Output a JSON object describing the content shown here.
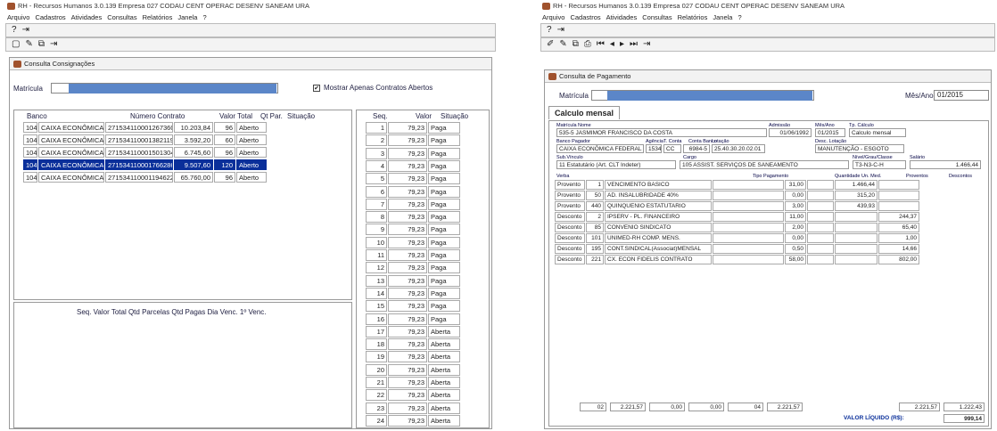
{
  "app": {
    "title": "RH - Recursos Humanos 3.0.139 Empresa 027 CODAU CENT OPERAC DESENV SANEAM URA",
    "menu": [
      "Arquivo",
      "Cadastros",
      "Atividades",
      "Consultas",
      "Relatórios",
      "Janela",
      "?"
    ]
  },
  "consig": {
    "window_title": "Consulta Consignações",
    "matricula_label": "Matrícula",
    "checkbox_label": "Mostrar Apenas Contratos Abertos",
    "checkbox_mark": "✔",
    "headers": [
      "Banco",
      "Número Contrato",
      "Valor Total",
      "Qt Par.",
      "Situação"
    ],
    "rows": [
      [
        "104",
        "CAIXA ECONÔMICA",
        "271534110001267360",
        "10.203,84",
        "96",
        "Aberto"
      ],
      [
        "104",
        "CAIXA ECONÔMICA",
        "271534110001382119",
        "3.592,20",
        "60",
        "Aberto"
      ],
      [
        "104",
        "CAIXA ECONÔMICA",
        "271534110001501304",
        "6.745,60",
        "96",
        "Aberto"
      ],
      [
        "104",
        "CAIXA ECONÔMICA",
        "271534110001766286",
        "9.507,60",
        "120",
        "Aberto"
      ],
      [
        "104",
        "CAIXA ECONÔMICA",
        "271534110001194622",
        "65.760,00",
        "96",
        "Aberto"
      ]
    ],
    "selected_row": 3,
    "bottom_headers": "Seq.  Valor Total  Qtd Parcelas Qtd Pagas Dia Venc.  1º Venc.",
    "seq_headers": [
      "Seq.",
      "Valor",
      "Situação"
    ],
    "parcel_value": "79,23",
    "parcels": [
      [
        "1",
        "Paga"
      ],
      [
        "2",
        "Paga"
      ],
      [
        "3",
        "Paga"
      ],
      [
        "4",
        "Paga"
      ],
      [
        "5",
        "Paga"
      ],
      [
        "6",
        "Paga"
      ],
      [
        "7",
        "Paga"
      ],
      [
        "8",
        "Paga"
      ],
      [
        "9",
        "Paga"
      ],
      [
        "10",
        "Paga"
      ],
      [
        "11",
        "Paga"
      ],
      [
        "12",
        "Paga"
      ],
      [
        "13",
        "Paga"
      ],
      [
        "14",
        "Paga"
      ],
      [
        "15",
        "Paga"
      ],
      [
        "16",
        "Paga"
      ],
      [
        "17",
        "Aberta"
      ],
      [
        "18",
        "Aberta"
      ],
      [
        "19",
        "Aberta"
      ],
      [
        "20",
        "Aberta"
      ],
      [
        "21",
        "Aberta"
      ],
      [
        "22",
        "Aberta"
      ],
      [
        "23",
        "Aberta"
      ],
      [
        "24",
        "Aberta"
      ]
    ]
  },
  "pag": {
    "window_title": "Consulta de Pagamento",
    "matricula_label": "Matrícula",
    "mes_label": "Mês/Ano",
    "mes_value": "01/2015",
    "tab_label": "Calculo mensal",
    "lbl_matricula": "Matrícula",
    "lbl_nome": "Nome",
    "lbl_admissao": "Admissão",
    "lbl_mesano": "Mês/Ano",
    "lbl_calculo": "Tp. Cálculo",
    "matricula_val": "535-5",
    "nome_val": "JASMIMOR FRANCISCO DA COSTA",
    "admissao_val": "01/06/1992",
    "mesano_val": "01/2015",
    "calculo_val": "Calculo mensal",
    "lbl_banco": "Banco Pagador",
    "lbl_agencia": "Agência",
    "lbl_tconta": "T. Conta",
    "lbl_conta": "Conta Banco",
    "lbl_lotacao": "Lotação",
    "lbl_desc_lot": "Desc. Lotação",
    "banco_val": "CAIXA ECONÔMICA FEDERAL",
    "agencia_val": "1534",
    "tconta_val": "CC",
    "conta_val": "6984-5",
    "lotacao_val": "25.40.30.20.02.01",
    "desc_lot_val": "MANUTENÇÃO - ESGOTO",
    "lbl_sub": "Sub.Vínculo",
    "lbl_cargo": "Cargo",
    "lbl_nivel": "Nível/Grau/Classe",
    "lbl_salario": "Salário",
    "sub_val": "11 Estatutário (Art. CLT Indeter)",
    "cargo_val": "105 ASSIST. SERVIÇOS DE SANEAMENTO",
    "nivel_val": "T3-N3-C-H",
    "salario_val": "1.466,44",
    "col_headers": [
      "Verba",
      "Tipo Pagamento",
      "Quantidade",
      "Un. Med.",
      "Proventos",
      "Descontos"
    ],
    "lines": [
      [
        "Provento",
        "1",
        "VENCIMENTO BASICO",
        "31,00",
        "1.466,44",
        ""
      ],
      [
        "Provento",
        "50",
        "AD. INSALUBRIDADE 40%",
        "0,00",
        "315,20",
        ""
      ],
      [
        "Provento",
        "440",
        "QUINQUENIO ESTATUTARIO",
        "3,00",
        "439,93",
        ""
      ],
      [
        "Desconto",
        "2",
        "IPSERV - PL. FINANCEIRO",
        "11,00",
        "",
        "244,37"
      ],
      [
        "Desconto",
        "85",
        "CONVENIO SINDICATO",
        "2,00",
        "",
        "65,40"
      ],
      [
        "Desconto",
        "101",
        "UNIMED-RH COMP. MENS.",
        "0,00",
        "",
        "1,00"
      ],
      [
        "Desconto",
        "195",
        "CONT.SINDICAL(Associat)MENSAL",
        "0,50",
        "",
        "14,66"
      ],
      [
        "Desconto",
        "221",
        "CX. ECON FIDELIS CONTRATO",
        "58,00",
        "",
        "802,00"
      ]
    ],
    "totals": {
      "v1": "02",
      "v2": "2.221,57",
      "v3": "0,00",
      "v4": "0,00",
      "v5": "04",
      "v6": "2.221,57",
      "proventos": "2.221,57",
      "descontos": "1.222,43",
      "liquido_label": "VALOR LÍQUIDO (R$):",
      "liquido": "999,14"
    }
  }
}
